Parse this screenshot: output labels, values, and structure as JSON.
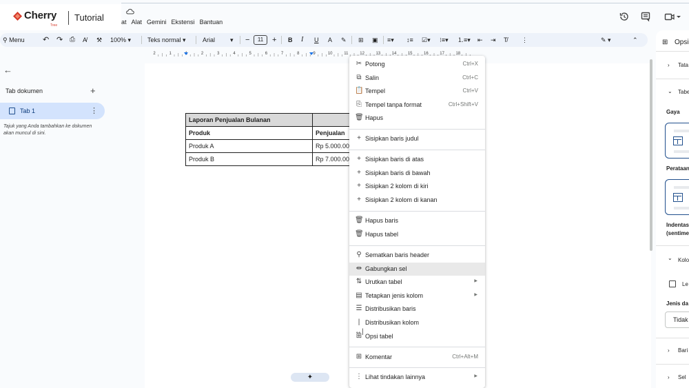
{
  "brand": {
    "name": "Cherry",
    "sub": "Tree",
    "tutorial": "Tutorial"
  },
  "menubar": [
    "at",
    "Alat",
    "Gemini",
    "Ekstensi",
    "Bantuan"
  ],
  "toolbar": {
    "menu_label": "Menu",
    "zoom": "100%",
    "style": "Teks normal",
    "font": "Arial",
    "font_size": "11"
  },
  "ruler": [
    "2",
    "1",
    "1",
    "2",
    "3",
    "4",
    "5",
    "6",
    "7",
    "8",
    "9",
    "10",
    "11",
    "12",
    "13",
    "14",
    "15",
    "16",
    "17",
    "18"
  ],
  "left_panel": {
    "section_title": "Tab dokumen",
    "tab_label": "Tab 1",
    "hint": "Tajuk yang Anda tambahkan ke dokumen akan muncul di sini."
  },
  "doc_table": {
    "title": "Laporan Penjualan Bulanan",
    "headers": [
      "Produk",
      "Penjualan"
    ],
    "rows": [
      [
        "Produk A",
        "Rp 5.000.00"
      ],
      [
        "Produk B",
        "Rp 7.000.00"
      ]
    ]
  },
  "context_menu": {
    "items": [
      {
        "icon": "scissors-icon",
        "label": "Potong",
        "shortcut": "Ctrl+X"
      },
      {
        "icon": "copy-icon",
        "label": "Salin",
        "shortcut": "Ctrl+C"
      },
      {
        "icon": "paste-icon",
        "label": "Tempel",
        "shortcut": "Ctrl+V"
      },
      {
        "icon": "paste-plain-icon",
        "label": "Tempel tanpa format",
        "shortcut": "Ctrl+Shift+V"
      },
      {
        "icon": "trash-icon",
        "label": "Hapus",
        "shortcut": ""
      },
      {
        "icon": "plus-icon",
        "label": "Sisipkan baris judul",
        "shortcut": ""
      },
      {
        "icon": "plus-icon",
        "label": "Sisipkan baris di atas",
        "shortcut": ""
      },
      {
        "icon": "plus-icon",
        "label": "Sisipkan baris di bawah",
        "shortcut": ""
      },
      {
        "icon": "plus-icon",
        "label": "Sisipkan 2 kolom di kiri",
        "shortcut": ""
      },
      {
        "icon": "plus-icon",
        "label": "Sisipkan 2 kolom di kanan",
        "shortcut": ""
      },
      {
        "icon": "trash-icon",
        "label": "Hapus baris",
        "shortcut": ""
      },
      {
        "icon": "trash-icon",
        "label": "Hapus tabel",
        "shortcut": ""
      },
      {
        "icon": "pin-icon",
        "label": "Sematkan baris header",
        "shortcut": ""
      },
      {
        "icon": "merge-icon",
        "label": "Gabungkan sel",
        "shortcut": ""
      },
      {
        "icon": "sort-icon",
        "label": "Urutkan tabel",
        "shortcut": ""
      },
      {
        "icon": "column-type-icon",
        "label": "Tetapkan jenis kolom",
        "shortcut": ""
      },
      {
        "icon": "distribute-rows-icon",
        "label": "Distribusikan baris",
        "shortcut": ""
      },
      {
        "icon": "distribute-columns-icon",
        "label": "Distribusikan kolom",
        "shortcut": ""
      },
      {
        "icon": "table-options-icon",
        "label": "Opsi tabel",
        "shortcut": ""
      },
      {
        "icon": "comment-icon",
        "label": "Komentar",
        "shortcut": "Ctrl+Alt+M"
      },
      {
        "icon": "more-vert-icon",
        "label": "Lihat tindakan lainnya",
        "shortcut": ""
      }
    ],
    "highlighted": "Gabungkan sel"
  },
  "right_panel": {
    "title": "Opsi",
    "tata": "Tata",
    "tabel": "Tabe",
    "gaya": "Gaya",
    "perataan": "Perataan",
    "indentasi": "Indentas",
    "sentimeter": "(sentime",
    "kolom": "Kolo",
    "lebar": "Le",
    "jenis_data": "Jenis da",
    "tidak": "Tidak",
    "baris": "Bari",
    "sel": "Sel"
  },
  "gemini_chip": "✦",
  "colors": {
    "accent": "#1f4e8c",
    "tab_bg": "#d3e3fd",
    "toolbar_bg": "#edf2fa",
    "brand_red": "#d63b2b"
  }
}
